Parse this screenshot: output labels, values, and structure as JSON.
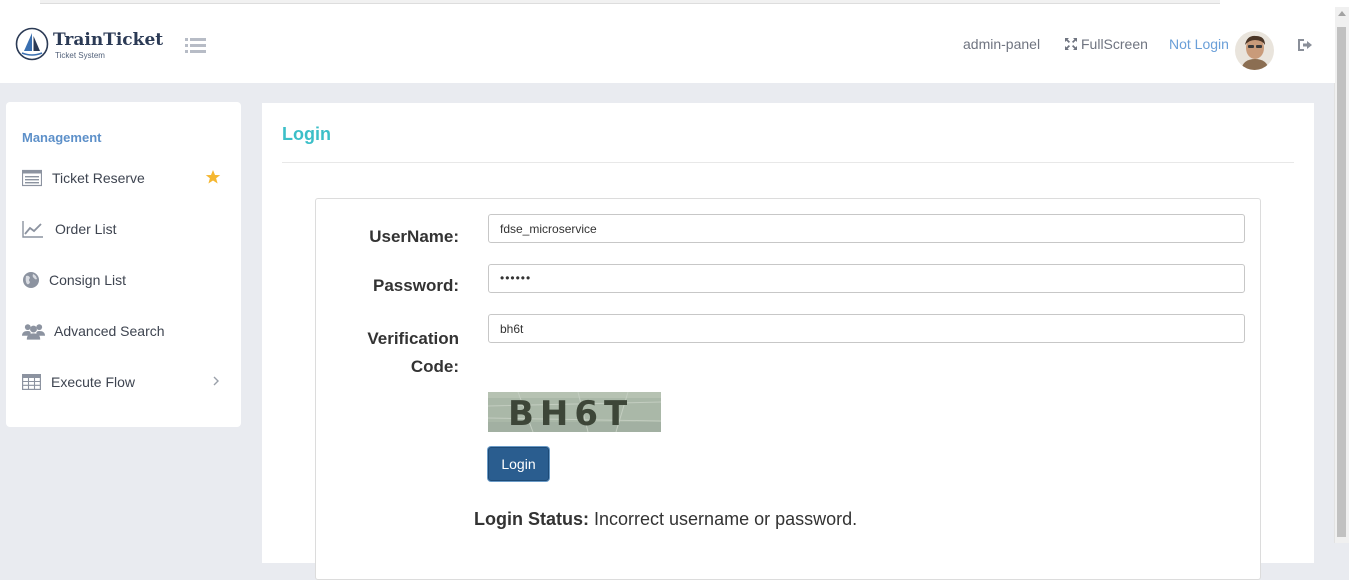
{
  "header": {
    "brand": "TrainTicket",
    "brand_sub": "Ticket System",
    "admin_panel": "admin-panel",
    "fullscreen": "FullScreen",
    "login_state": "Not Login"
  },
  "sidebar": {
    "heading": "Management",
    "items": [
      {
        "label": "Ticket Reserve",
        "icon": "list-card-icon",
        "starred": true
      },
      {
        "label": "Order List",
        "icon": "line-chart-icon"
      },
      {
        "label": "Consign List",
        "icon": "globe-icon"
      },
      {
        "label": "Advanced Search",
        "icon": "users-icon"
      },
      {
        "label": "Execute Flow",
        "icon": "table-icon",
        "has_submenu": true
      }
    ]
  },
  "page": {
    "title": "Login",
    "form": {
      "username_label": "UserName:",
      "username_value": "fdse_microservice",
      "password_label": "Password:",
      "password_value": "••••••",
      "verification_label_line1": "Verification",
      "verification_label_line2": "Code:",
      "verification_value": "bh6t",
      "captcha_text": "BH6T",
      "login_button": "Login",
      "status_label": "Login Status:",
      "status_message": "Incorrect username or password."
    }
  },
  "colors": {
    "accent_title": "#3cbfc8",
    "link_blue": "#6a9fd8",
    "button_blue": "#2a5d8f",
    "sidebar_heading": "#5d90c9",
    "star": "#f5b731"
  }
}
